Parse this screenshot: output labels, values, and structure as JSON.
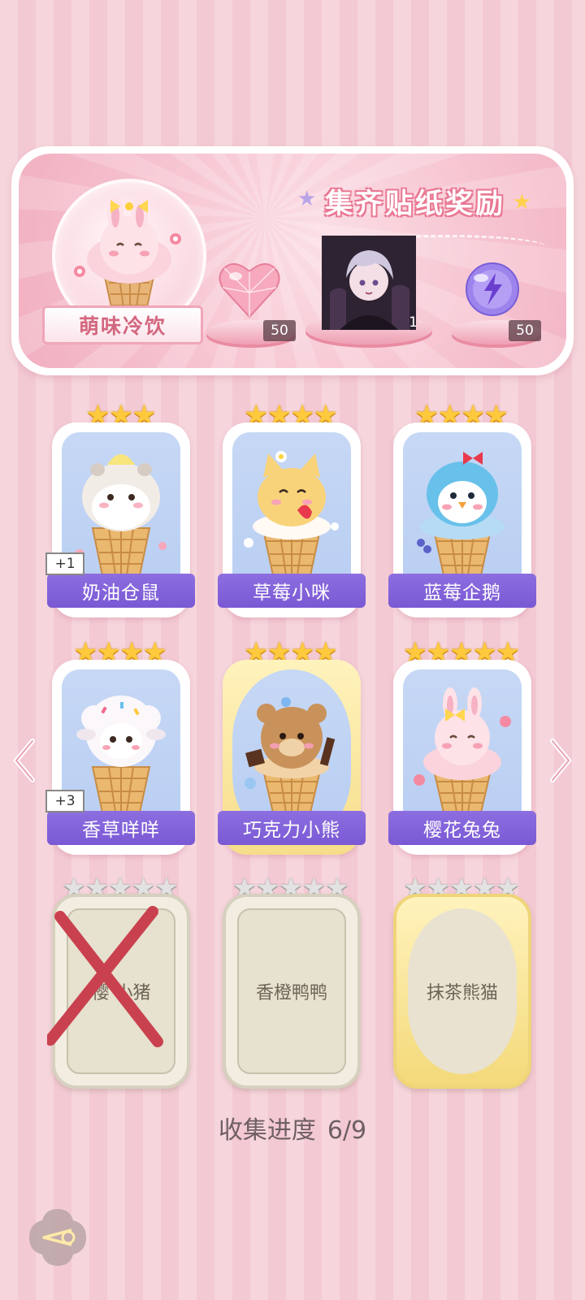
{
  "banner": {
    "title": "集齐贴纸奖励",
    "collection_name": "萌味冷饮",
    "rewards": [
      {
        "icon": "pink-heart-gem-icon",
        "count": "50"
      },
      {
        "icon": "character-portrait-icon",
        "count": "1"
      },
      {
        "icon": "purple-energy-orb-icon",
        "count": "50"
      }
    ]
  },
  "stickers": [
    {
      "name": "奶油仓鼠",
      "stars": 3,
      "badge": "+1",
      "owned": true,
      "frame": "normal"
    },
    {
      "name": "草莓小咪",
      "stars": 4,
      "badge": "",
      "owned": true,
      "frame": "normal"
    },
    {
      "name": "蓝莓企鹅",
      "stars": 4,
      "badge": "",
      "owned": true,
      "frame": "normal"
    },
    {
      "name": "香草咩咩",
      "stars": 4,
      "badge": "+3",
      "owned": true,
      "frame": "normal"
    },
    {
      "name": "巧克力小熊",
      "stars": 4,
      "badge": "",
      "owned": true,
      "frame": "gold"
    },
    {
      "name": "樱花兔兔",
      "stars": 5,
      "badge": "",
      "owned": true,
      "frame": "normal"
    },
    {
      "name": "樱 小猪",
      "stars": 5,
      "badge": "",
      "owned": false,
      "frame": "normal",
      "crossed_out": true
    },
    {
      "name": "香橙鸭鸭",
      "stars": 5,
      "badge": "",
      "owned": false,
      "frame": "normal"
    },
    {
      "name": "抹茶熊猫",
      "stars": 5,
      "badge": "",
      "owned": false,
      "frame": "gold"
    }
  ],
  "progress": {
    "label": "收集进度",
    "value": "6/9"
  },
  "colors": {
    "accent_pink": "#e97893",
    "label_purple": "#7a59d4",
    "star_gold": "#ffc93e"
  }
}
